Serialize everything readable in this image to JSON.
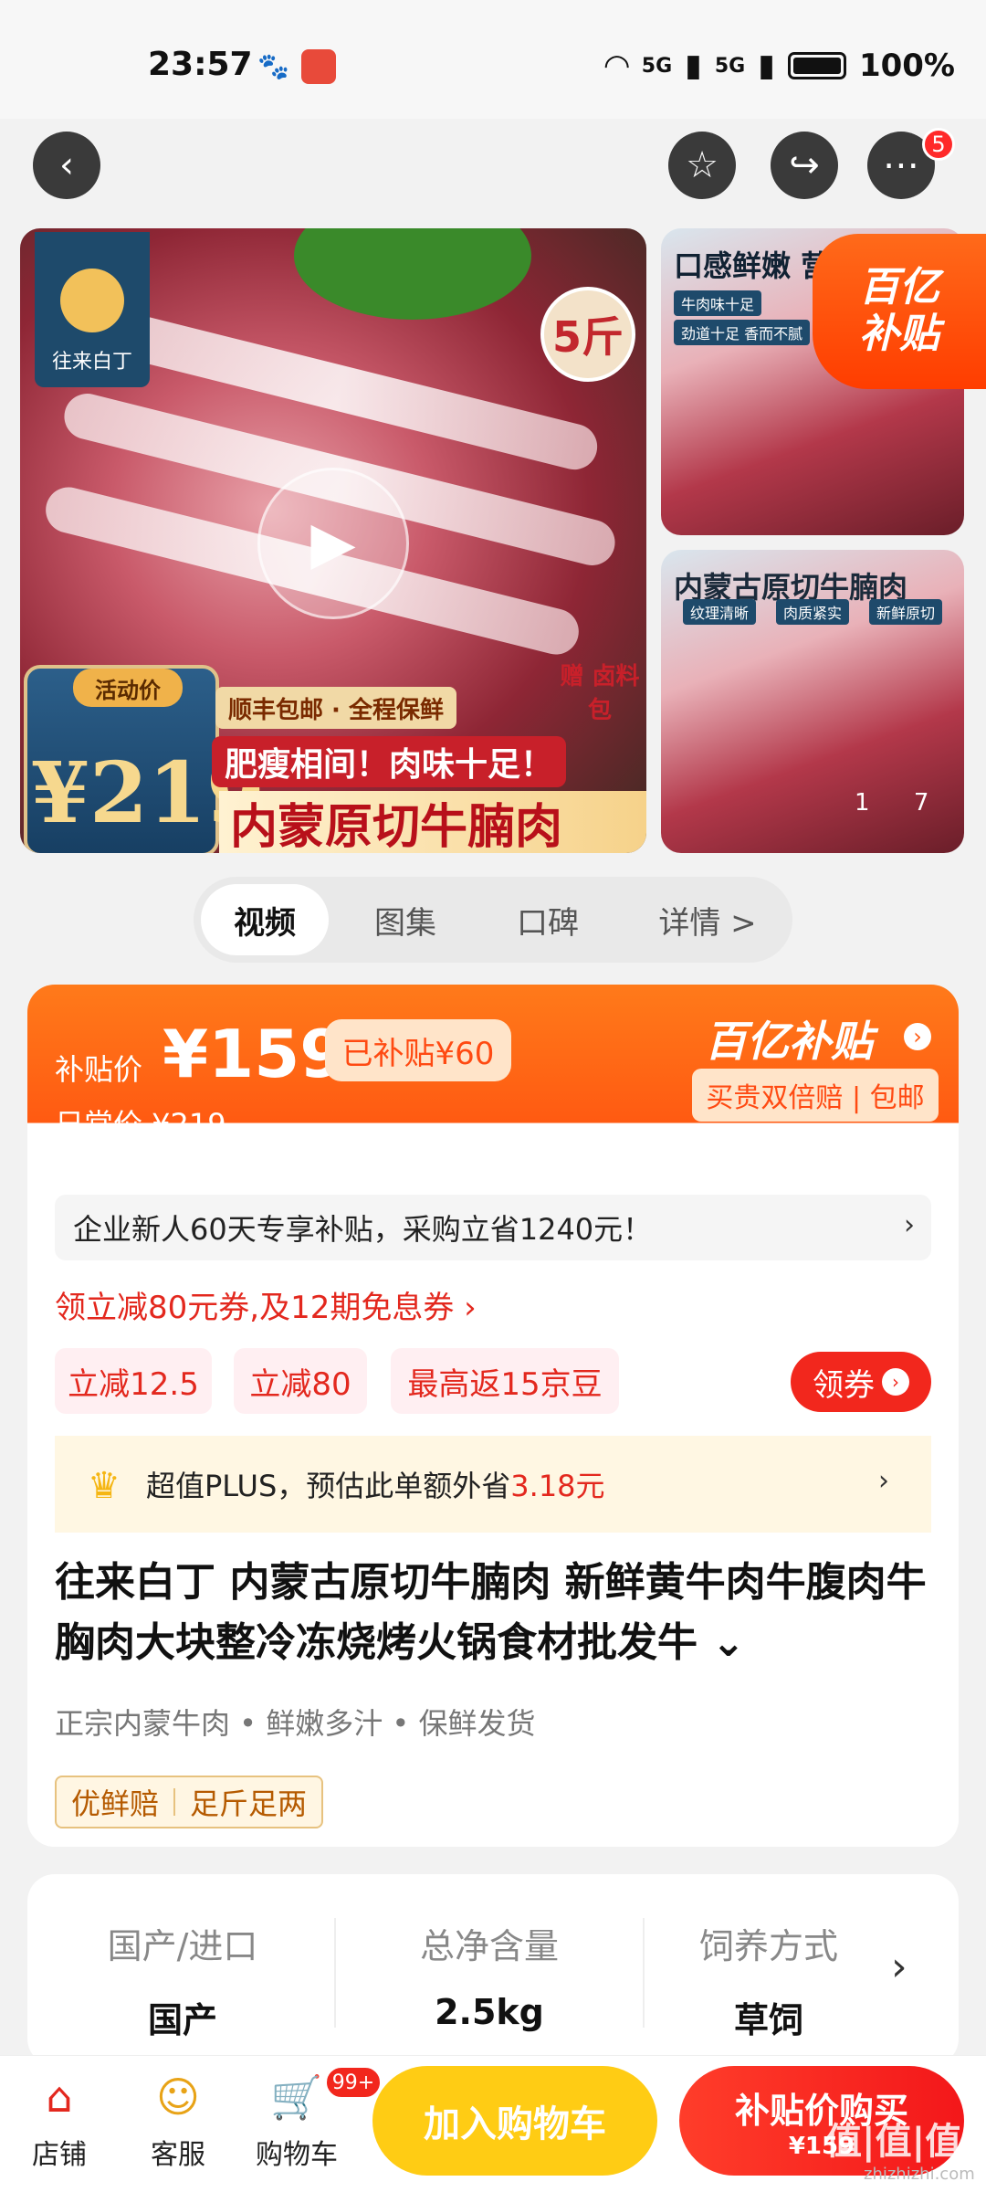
{
  "status_bar": {
    "time": "23:57",
    "signal1": "5G",
    "signal2": "5G",
    "battery": "100%"
  },
  "top_bar": {
    "badge_count": "5"
  },
  "gallery": {
    "brand": "往来白丁",
    "weight": "5斤",
    "activity_label": "活动价",
    "activity_price": "¥219",
    "shipping": "顺丰包邮 · 全程保鲜",
    "slogan": "肥瘦相间！肉味十足！",
    "banner_title": "内蒙原切牛腩肉",
    "gift": "赠 卤料包",
    "thumb1_title": "口感鲜嫩 营养",
    "thumb1_chips": [
      "牛肉味十足",
      "劲道十足 香而不腻"
    ],
    "thumb2_title": "内蒙古原切牛腩肉",
    "thumb2_chips": [
      "纹理清晰",
      "肉质紧实",
      "新鲜原切"
    ],
    "subsidy_corner_1": "百亿",
    "subsidy_corner_2": "补贴",
    "page_current": "1",
    "page_total": "7"
  },
  "tabs": [
    {
      "label": "视频"
    },
    {
      "label": "图集"
    },
    {
      "label": "口碑"
    },
    {
      "label": "详情 >"
    }
  ],
  "price_card": {
    "subsidy_label": "补贴价",
    "subsidy_price": "¥159",
    "subsidy_saved": "已补贴¥60",
    "daily_price": "日常价 ¥219",
    "brand_subsidy": "百亿补贴",
    "guarantee": "买贵双倍赔 | 包邮",
    "enterprise": "企业新人60天专享补贴，采购立省1240元！",
    "coupon_link": "领立减80元券,及12期免息券 ›",
    "chips": [
      "立减12.5",
      "立减80",
      "最高返15京豆"
    ],
    "get_coupon": "领券",
    "plus_prefix": "超值PLUS，预估此单额外省",
    "plus_amount": "3.18元",
    "product_title": "往来白丁 内蒙古原切牛腩肉 新鲜黄牛肉牛腹肉牛胸肉大块整冷冻烧烤火锅食材批发牛 ⌄",
    "selling_points": "正宗内蒙牛肉 • 鲜嫩多汁 • 保鲜发货",
    "tags": [
      "优鲜赔",
      "足斤足两"
    ]
  },
  "specs": [
    {
      "label": "国产/进口",
      "value": "国产"
    },
    {
      "label": "总净含量",
      "value": "2.5kg"
    },
    {
      "label": "饲养方式",
      "value": "草饲"
    }
  ],
  "bottom_bar": {
    "shop": "店铺",
    "service": "客服",
    "cart": "购物车",
    "cart_badge": "99+",
    "add_to_cart": "加入购物车",
    "buy_line1": "补贴价购买",
    "buy_line2": "¥159",
    "watermark": "值|值|值",
    "watermark_sub": "zhizhizhi.com"
  }
}
